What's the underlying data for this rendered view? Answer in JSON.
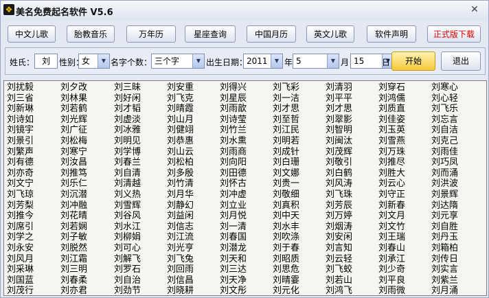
{
  "window": {
    "title": "美名免费起名软件 V5.6",
    "close_glyph": "✕"
  },
  "toolbar": [
    {
      "label": "中文儿歌",
      "accent": false
    },
    {
      "label": "胎教音乐",
      "accent": false
    },
    {
      "label": "万年历",
      "accent": false
    },
    {
      "label": "星座查询",
      "accent": false
    },
    {
      "label": "中国月历",
      "accent": false
    },
    {
      "label": "英文儿歌",
      "accent": false
    },
    {
      "label": "软件声明",
      "accent": false
    },
    {
      "label": "正式版下载",
      "accent": true
    }
  ],
  "form": {
    "surname_label": "姓氏：",
    "surname_value": "刘",
    "gender_label": "性别：",
    "gender_value": "女",
    "count_label": "名字个数：",
    "count_value": "三个字",
    "birth_label": "出生日期：",
    "year_value": "2011",
    "year_unit": "年",
    "month_value": "5",
    "month_unit": "月",
    "day_value": "15",
    "day_unit": "日",
    "start_label": "开始",
    "exit_label": "退出"
  },
  "names": [
    [
      "刘扰毅",
      "刘三省",
      "刘新琳",
      "刘诗如",
      "刘镜宇",
      "刘景引",
      "刘繁声",
      "刘有德",
      "刘亦奇",
      "刘文宁",
      "刘飞琼",
      "刘芳梨",
      "刘推今",
      "刘席引",
      "刘学之",
      "刘永安",
      "刘风月",
      "刘采琳",
      "刘国蓝",
      "刘茂行"
    ],
    [
      "刘夕改",
      "刘林果",
      "刘若鹤",
      "刘光辉",
      "刘广征",
      "刘松梅",
      "刘寒宁",
      "刘汝昌",
      "刘推笃",
      "刘乐仁",
      "刘沉潜",
      "刘冲融",
      "刘花晴",
      "刘若娴",
      "刘子敏",
      "刘脱然",
      "刘江霜",
      "刘三明",
      "刘春柔",
      "刘亦君"
    ],
    [
      "刘三昧",
      "刘好闲",
      "刘才韬",
      "刘虚淡",
      "刘冰雅",
      "刘明见",
      "刘学博",
      "刘春兰",
      "刘自清",
      "刘清越",
      "刘义热",
      "刘雪辉",
      "刘谷风",
      "刘水江",
      "刘柳娟",
      "刘可心",
      "刘解飞",
      "刘罗石",
      "刘自治",
      "刘劲节"
    ],
    [
      "刘安重",
      "刘飞克",
      "刘晴霞",
      "刘山月",
      "刘健翊",
      "刘恭惠",
      "刘山云",
      "刘松柏",
      "刘多殷",
      "刘竹清",
      "刘月华",
      "刘静幻",
      "刘益闲",
      "刘信志",
      "刘江流",
      "刘光亨",
      "刘飞兔",
      "刘回雨",
      "刘信昌",
      "刘晓耕"
    ],
    [
      "刘得兴",
      "刘星辰",
      "刘雨歆",
      "刘诗莹",
      "刘竹兰",
      "刘水熏",
      "刘雨商",
      "刘向阳",
      "刘田德",
      "刘怀古",
      "刘冲虚",
      "刘立业",
      "刘月悦",
      "刘一清",
      "刘春国",
      "刘潜龙",
      "刘天和",
      "刘三达",
      "刘天净",
      "刘文彤"
    ],
    [
      "刘飞彩",
      "刘一洁",
      "刘才思",
      "刘至哲",
      "刘江民",
      "刘明若",
      "刘成针",
      "刘白珊",
      "刘文娜",
      "刘贵一",
      "刘敬细",
      "刘真积",
      "刘中天",
      "刘水丰",
      "刘吹涤",
      "刘于春",
      "刘昭质",
      "刘思危",
      "刘晴霎",
      "刘元化"
    ],
    [
      "刘清羽",
      "刘平平",
      "刘才思",
      "刘翠影",
      "刘智明",
      "刘闽汰",
      "刘茂辉",
      "刘敬引",
      "刘白鹤",
      "刘风涛",
      "刘飞珠",
      "刘芳辰",
      "刘万婷",
      "刘烟涛",
      "刘安闲",
      "刘言知",
      "刘云轻",
      "刘飞蛟",
      "刘若山",
      "刘鸿飞"
    ],
    [
      "刘穿石",
      "刘鸿儒",
      "刘质直",
      "刘佳姿",
      "刘玉英",
      "刘雪燕",
      "刘万珠",
      "刘推尽",
      "刘胜大",
      "刘云心",
      "刘守正",
      "刘新春",
      "刘文月",
      "刘文竹",
      "刘王瑞",
      "刘春山",
      "刘承江",
      "刘少奇",
      "刘平良",
      "刘雨微"
    ],
    [
      "刘寒心",
      "刘心轻",
      "刘飞乐",
      "刘忘言",
      "刘自洁",
      "刘克己",
      "刘雨佳",
      "刘巧凤",
      "刘而涌",
      "刘洪波",
      "刘景辉",
      "刘达隋",
      "刘元享",
      "刘自胜",
      "刘丹玉",
      "刘箱柏",
      "刘传日",
      "刘实言",
      "刘紫兰",
      "刘月涌"
    ]
  ]
}
